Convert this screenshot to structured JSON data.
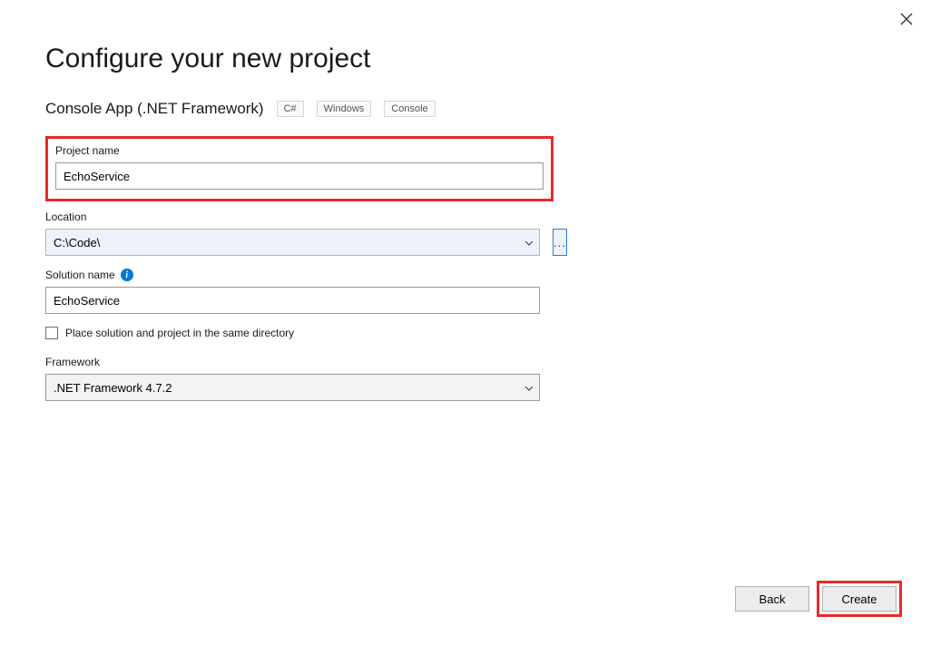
{
  "title": "Configure your new project",
  "template": {
    "name": "Console App (.NET Framework)",
    "tags": [
      "C#",
      "Windows",
      "Console"
    ]
  },
  "projectName": {
    "label": "Project name",
    "value": "EchoService"
  },
  "location": {
    "label": "Location",
    "value": "C:\\Code\\",
    "browseLabel": "..."
  },
  "solutionName": {
    "label": "Solution name",
    "value": "EchoService"
  },
  "sameDirectory": {
    "label": "Place solution and project in the same directory",
    "checked": false
  },
  "framework": {
    "label": "Framework",
    "value": ".NET Framework 4.7.2"
  },
  "buttons": {
    "back": "Back",
    "create": "Create"
  }
}
